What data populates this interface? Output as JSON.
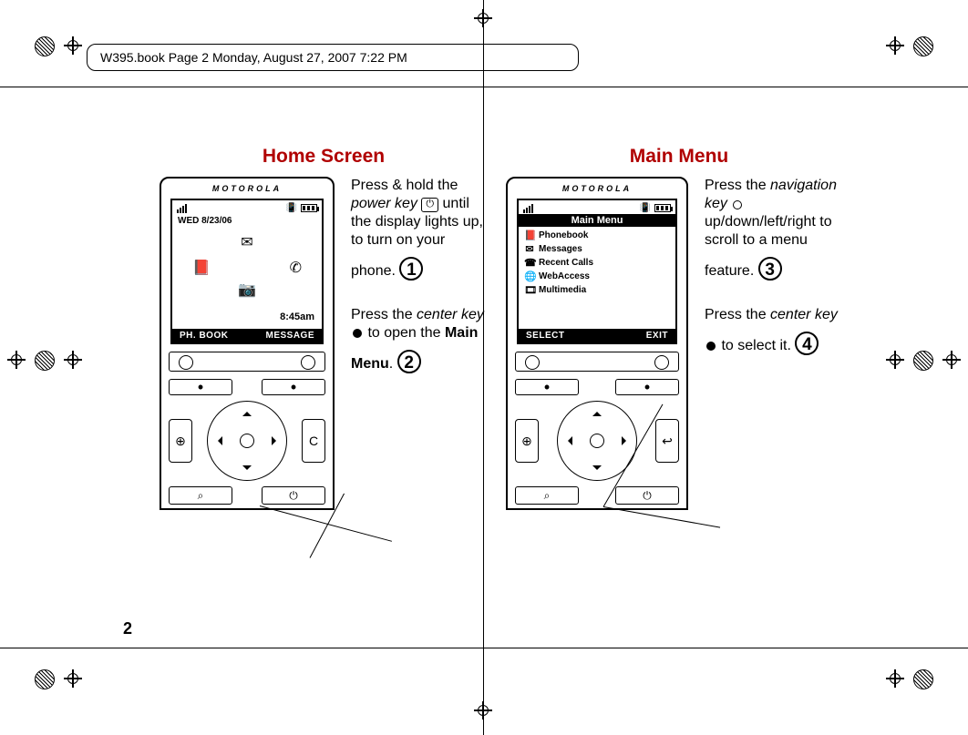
{
  "doc": {
    "running_header": "W395.book  Page 2  Monday, August 27, 2007  7:22 PM",
    "page_number": "2"
  },
  "left": {
    "title": "Home Screen",
    "phone": {
      "brand": "MOTOROLA",
      "date": "WED 8/23/06",
      "time": "8:45am",
      "soft_left": "PH. BOOK",
      "soft_right": "MESSAGE"
    },
    "step1": {
      "badge": "1",
      "text_a": "Press & hold the ",
      "text_b_it": "power key",
      "text_c": " until the display lights up, to turn on your phone."
    },
    "step2": {
      "badge": "2",
      "text_a": "Press the ",
      "text_b_it": "center key",
      "text_c": " to open the ",
      "text_d_bold": "Main Menu",
      "text_e": "."
    }
  },
  "right": {
    "title": "Main Menu",
    "phone": {
      "brand": "MOTOROLA",
      "menu_title": "Main Menu",
      "items": [
        {
          "icon": "📕",
          "label": "Phonebook"
        },
        {
          "icon": "✉",
          "label": "Messages"
        },
        {
          "icon": "☎",
          "label": "Recent Calls"
        },
        {
          "icon": "🌐",
          "label": "WebAccess"
        },
        {
          "icon": "🎞",
          "label": "Multimedia"
        }
      ],
      "soft_left": "SELECT",
      "soft_right": "EXIT"
    },
    "step3": {
      "badge": "3",
      "text_a": "Press the ",
      "text_b_it": "navigation key",
      "text_c": " up/down/left/right to scroll to a menu feature."
    },
    "step4": {
      "badge": "4",
      "text_a": "Press the ",
      "text_b_it": "center key",
      "text_c": " to select it."
    }
  }
}
